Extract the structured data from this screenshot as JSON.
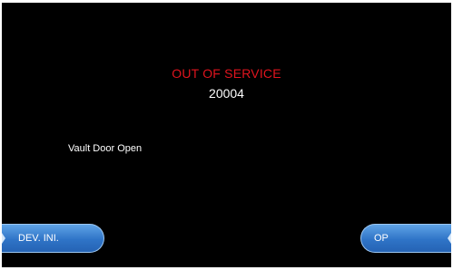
{
  "screen": {
    "title": "OUT OF SERVICE",
    "code": "20004",
    "message": "Vault Door Open"
  },
  "buttons": {
    "left_label": "DEV. INI.",
    "right_label": "OP"
  },
  "colors": {
    "background": "#000000",
    "title_color": "#e0141e",
    "text_color": "#ffffff",
    "button_color": "#2f74c7"
  }
}
